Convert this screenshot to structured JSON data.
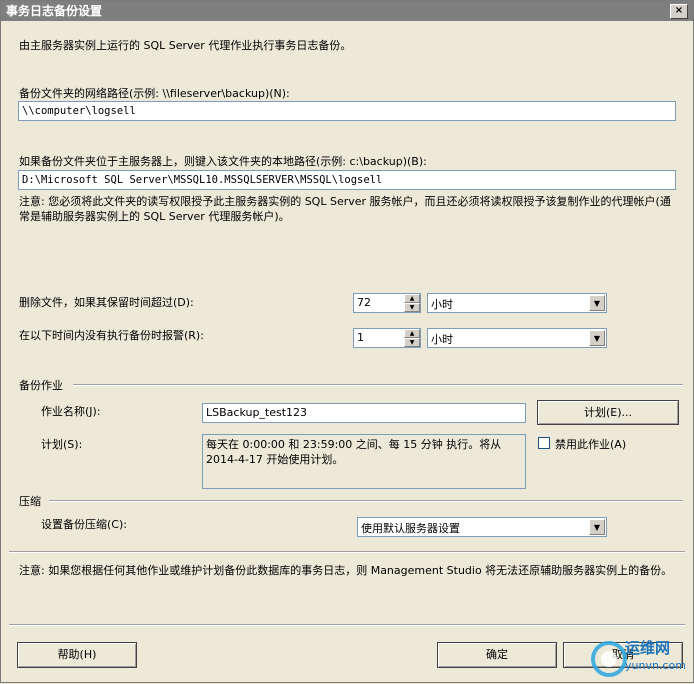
{
  "window": {
    "title": "事务日志备份设置",
    "close_glyph": "×"
  },
  "intro": "由主服务器实例上运行的 SQL Server 代理作业执行事务日志备份。",
  "network_path": {
    "label": "备份文件夹的网络路径(示例: \\\\fileserver\\backup)(N):",
    "value": "\\\\computer\\logsell"
  },
  "local_path": {
    "label": "如果备份文件夹位于主服务器上，则键入该文件夹的本地路径(示例: c:\\backup)(B):",
    "value": "D:\\Microsoft SQL Server\\MSSQL10.MSSQLSERVER\\MSSQL\\logsell",
    "note": "注意: 您必须将此文件夹的读写权限授予此主服务器实例的 SQL Server 服务帐户，而且还必须将读权限授予该复制作业的代理帐户(通常是辅助服务器实例上的 SQL Server 代理服务帐户)。"
  },
  "delete_files": {
    "label": "删除文件，如果其保留时间超过(D):",
    "value": "72",
    "unit": "小时"
  },
  "alert": {
    "label": "在以下时间内没有执行备份时报警(R):",
    "value": "1",
    "unit": "小时"
  },
  "backup_job": {
    "group_label": "备份作业",
    "job_name_label": "作业名称(J):",
    "job_name_value": "LSBackup_test123",
    "schedule_button": "计划(E)...",
    "schedule_label": "计划(S):",
    "schedule_text": "每天在 0:00:00 和 23:59:00 之间、每 15 分钟 执行。将从 2014-4-17 开始使用计划。",
    "disable_label": "禁用此作业(A)",
    "disable_checked": false
  },
  "compression": {
    "group_label": "压缩",
    "label": "设置备份压缩(C):",
    "value": "使用默认服务器设置"
  },
  "footer_note": "注意: 如果您根据任何其他作业或维护计划备份此数据库的事务日志，则 Management Studio 将无法还原辅助服务器实例上的备份。",
  "buttons": {
    "help": "帮助(H)",
    "ok": "确定",
    "cancel": "取消"
  },
  "watermark": {
    "name": "运维网",
    "url": "yunvn.com"
  }
}
